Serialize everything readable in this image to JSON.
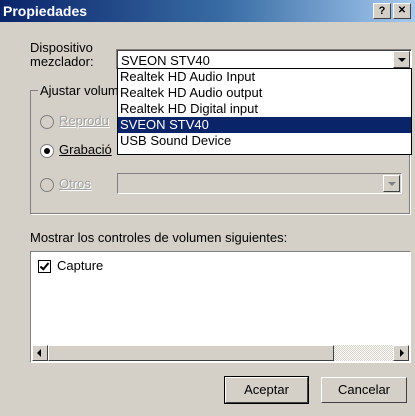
{
  "window": {
    "title": "Propiedades",
    "help_button": "?",
    "close_button": "✕"
  },
  "mixer": {
    "label_line1": "Dispositivo",
    "label_line2": "mezclador:",
    "selected": "SVEON STV40",
    "options": [
      "Realtek HD Audio Input",
      "Realtek HD Audio output",
      "Realtek HD Digital input",
      "SVEON STV40",
      "USB Sound Device"
    ],
    "selected_index": 3
  },
  "adjust_group": {
    "title": "Ajustar volum",
    "radios": [
      {
        "label": "Reprodu",
        "enabled": false,
        "checked": false
      },
      {
        "label": "Grabació",
        "enabled": true,
        "checked": true
      },
      {
        "label": "Otros",
        "enabled": false,
        "checked": false
      }
    ],
    "otros_combo_value": ""
  },
  "controls": {
    "label": "Mostrar los controles de volumen siguientes:",
    "items": [
      {
        "label": "Capture",
        "checked": true
      }
    ]
  },
  "buttons": {
    "ok": "Aceptar",
    "cancel": "Cancelar"
  },
  "colors": {
    "selection": "#0a246a",
    "titlebar_start": "#0a246a",
    "titlebar_end": "#a6caf0",
    "face": "#d4d0c8"
  }
}
